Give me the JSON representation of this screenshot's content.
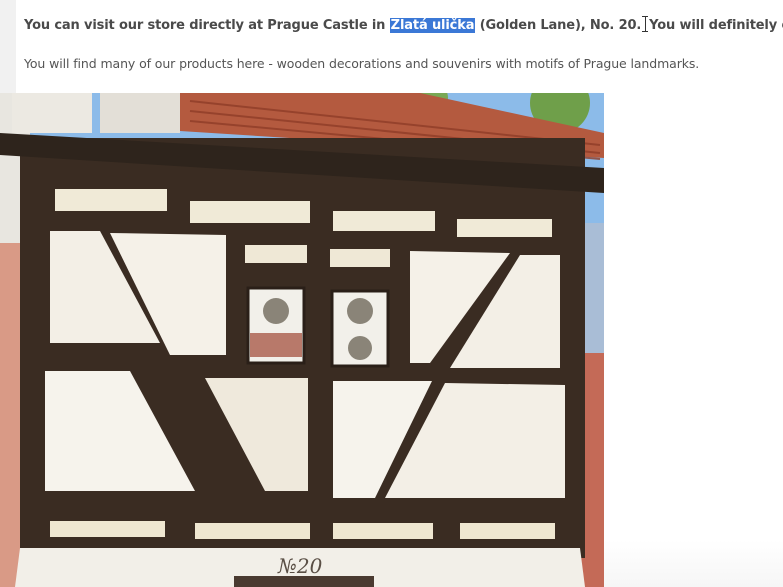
{
  "intro": {
    "before_highlight": "You can visit our store directly at Prague Castle in ",
    "highlight": "Zlatá ulička",
    "after_highlight": " (Golden Lane), No. 20.",
    "after_caret": "You will definitely enjoy it here."
  },
  "description": "You will find many of our products here - wooden decorations and souvenirs with motifs of Prague landmarks.",
  "photo": {
    "house_number": "№20"
  }
}
